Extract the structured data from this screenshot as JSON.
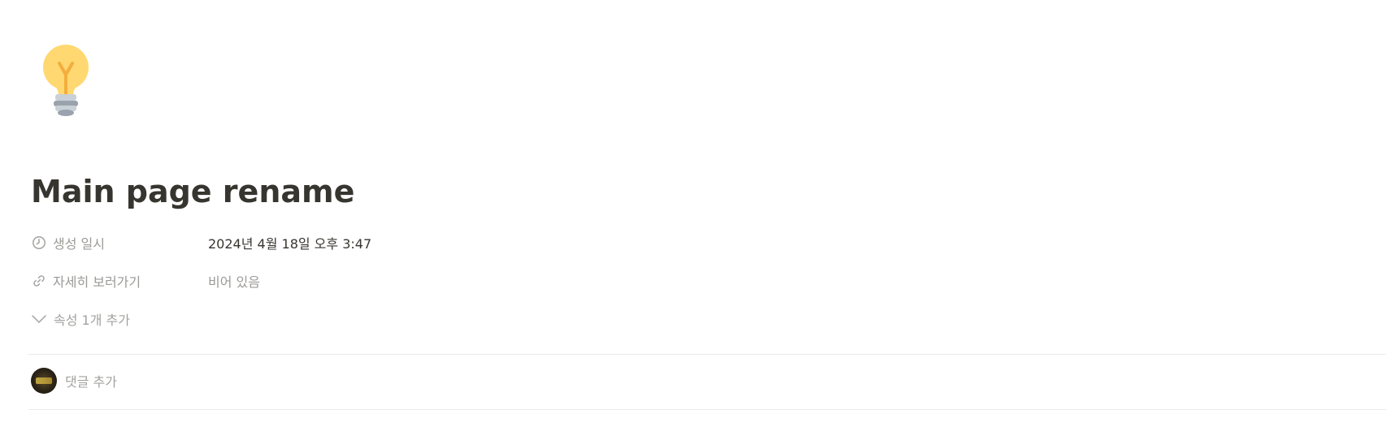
{
  "page": {
    "icon": "lightbulb-icon",
    "title": "Main page rename"
  },
  "properties": [
    {
      "icon": "clock-icon",
      "name": "생성 일시",
      "value": "2024년 4월 18일 오후 3:47",
      "empty": false
    },
    {
      "icon": "link-icon",
      "name": "자세히 보러가기",
      "value": "비어 있음",
      "empty": true
    }
  ],
  "more_properties": {
    "icon": "chevron-down-icon",
    "label": "속성 1개 추가"
  },
  "comment": {
    "placeholder": "댓글 추가"
  },
  "colors": {
    "text": "#37352f",
    "muted": "#9b9a97",
    "divider": "#e9e9e7",
    "bulb": "#ffd36b",
    "bulb_filament": "#f4a93a",
    "bulb_base": "#b8c0c8"
  }
}
